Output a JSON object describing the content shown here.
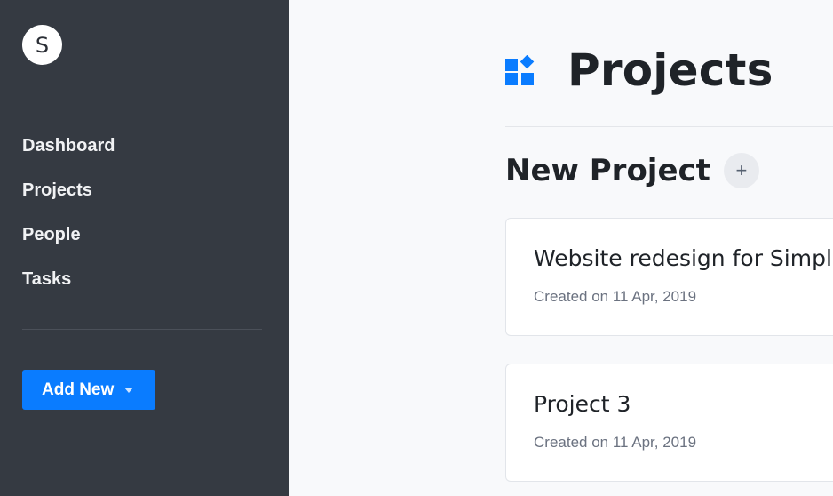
{
  "sidebar": {
    "avatar_initial": "S",
    "nav": [
      {
        "label": "Dashboard"
      },
      {
        "label": "Projects"
      },
      {
        "label": "People"
      },
      {
        "label": "Tasks"
      }
    ],
    "add_new_label": "Add New"
  },
  "main": {
    "title": "Projects",
    "title_icon": "projects-icon",
    "new_project_label": "New Project",
    "plus_label": "+",
    "projects": [
      {
        "name": "Website redesign for Simpl",
        "created": "Created on 11 Apr, 2019"
      },
      {
        "name": "Project 3",
        "created": "Created on 11 Apr, 2019"
      }
    ]
  },
  "colors": {
    "sidebar_bg": "#353a42",
    "accent": "#0a7cff",
    "page_bg": "#f8f9fb"
  }
}
